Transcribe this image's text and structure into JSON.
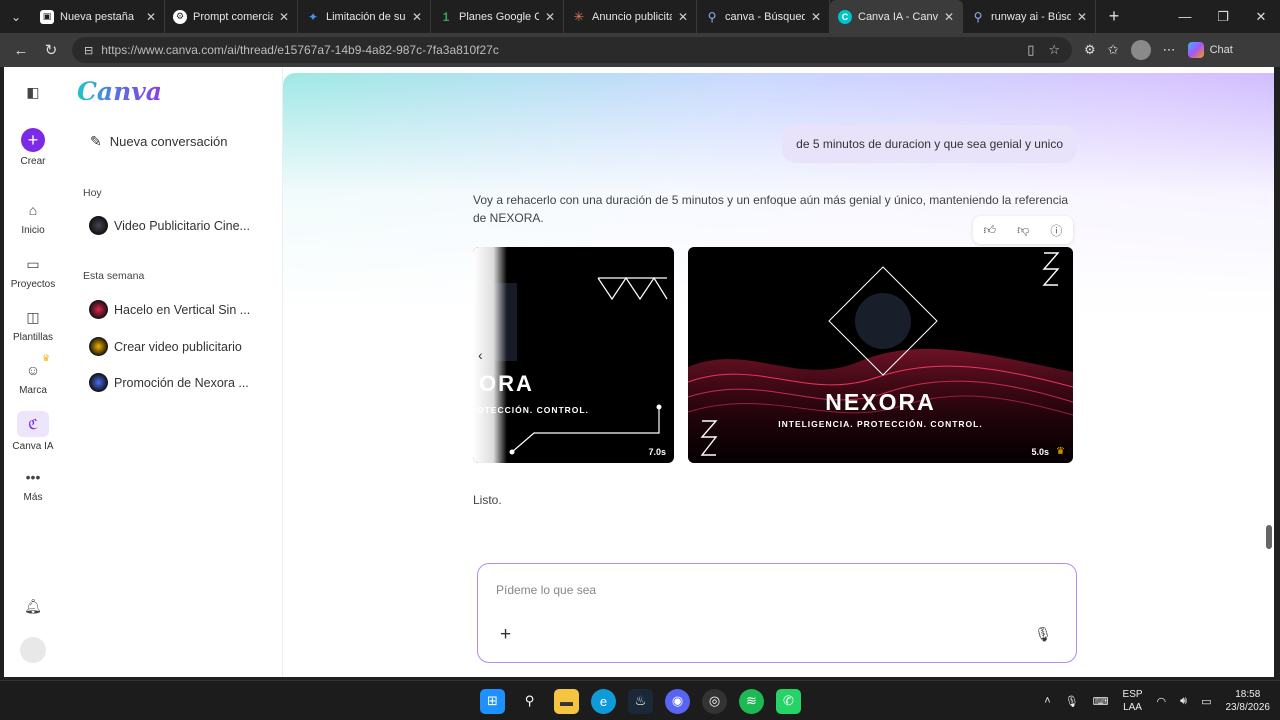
{
  "browser": {
    "tabs": [
      {
        "title": "Nueva pestaña",
        "favicon": "new-tab-icon",
        "color": "#2b2b2b",
        "active": false
      },
      {
        "title": "Prompt comercial",
        "favicon": "chatgpt-icon",
        "color": "#ffffff",
        "active": false
      },
      {
        "title": "Limitación de susc",
        "favicon": "gemini-icon",
        "color": "#4a8df8",
        "active": false
      },
      {
        "title": "Planes Google One",
        "favicon": "google-one-icon",
        "color": "#34a853",
        "active": false
      },
      {
        "title": "Anuncio publicitari",
        "favicon": "claude-icon",
        "color": "#d97757",
        "active": false
      },
      {
        "title": "canva - Búsqueda",
        "favicon": "search-icon",
        "color": "#3b82f6",
        "active": false
      },
      {
        "title": "Canva IA - Canva",
        "favicon": "canva-icon",
        "color": "#00c4cc",
        "active": true
      },
      {
        "title": "runway ai - Búsque",
        "favicon": "search-icon",
        "color": "#3b82f6",
        "active": false
      }
    ],
    "url": "https://www.canva.com/ai/thread/e15767a7-14b9-4a82-987c-7fa3a810f27c",
    "chat_label": "Chat"
  },
  "rail": {
    "items": [
      {
        "label": "Crear"
      },
      {
        "label": "Inicio"
      },
      {
        "label": "Proyectos"
      },
      {
        "label": "Plantillas"
      },
      {
        "label": "Marca"
      },
      {
        "label": "Canva IA"
      },
      {
        "label": "Más"
      }
    ]
  },
  "sidebar": {
    "logo": "Canva",
    "new_conversation": "Nueva conversación",
    "today_title": "Hoy",
    "today_items": [
      {
        "label": "Video Publicitario Cine..."
      }
    ],
    "week_title": "Esta semana",
    "week_items": [
      {
        "label": "Hacelo en Vertical Sin ..."
      },
      {
        "label": "Crear video publicitario"
      },
      {
        "label": "Promoción de Nexora ..."
      }
    ]
  },
  "chat": {
    "user_message": "de 5 minutos de duracion y que sea genial y unico",
    "assistant_reply": "Voy a rehacerlo con una duración de 5 minutos y un enfoque aún más genial y único, manteniendo la referencia de NEXORA.",
    "cards": [
      {
        "title": "ORA",
        "subtitle": "OTECCIÓN. CONTROL.",
        "duration": "7.0s"
      },
      {
        "title": "NEXORA",
        "subtitle": "INTELIGENCIA. PROTECCIÓN. CONTROL.",
        "duration": "5.0s"
      }
    ],
    "done_text": "Listo.",
    "input_placeholder": "Pídeme lo que sea"
  },
  "taskbar": {
    "lang_top": "ESP",
    "lang_bottom": "LAA",
    "time": "18:58",
    "date": "23/8/2026"
  },
  "colors": {
    "accent": "#7d2ae8",
    "neon_red": "#e0244c"
  }
}
